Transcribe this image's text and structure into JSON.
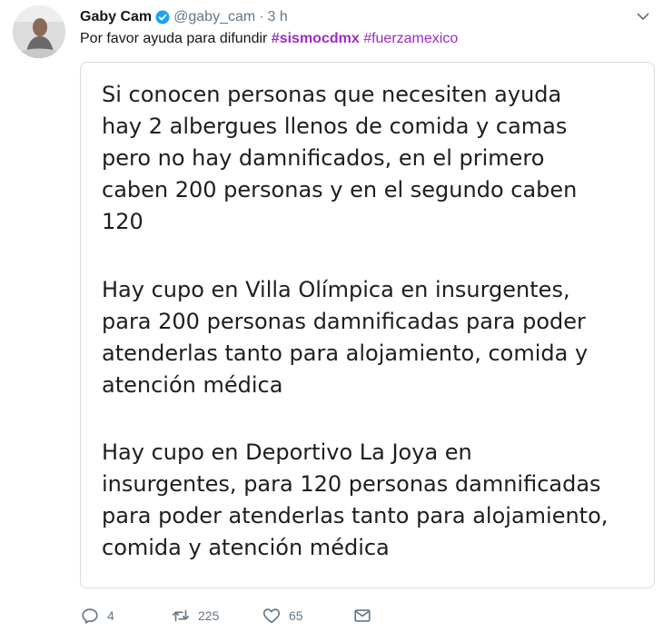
{
  "author": {
    "name": "Gaby Cam",
    "handle": "@gaby_cam",
    "separator": "·",
    "time": "3 h"
  },
  "tweet": {
    "text": "Por favor ayuda para difundir ",
    "hashtag1": "#sismocdmx",
    "hashtag2": "#fuerzamexico"
  },
  "image": {
    "paragraph1": "Si conocen personas que necesiten ayuda\nhay 2 albergues llenos de comida y camas\npero no hay damnificados, en el primero\ncaben 200 personas y en el segundo caben\n120",
    "paragraph2": "Hay cupo en Villa Olímpica en insurgentes,\npara 200 personas damnificadas para poder\natenderlas tanto para alojamiento, comida y\natención médica",
    "paragraph3": "Hay cupo en Deportivo La Joya en\ninsurgentes, para 120 personas damnificadas\npara poder atenderlas tanto para alojamiento,\ncomida y atención médica"
  },
  "actions": {
    "replies": "4",
    "retweets": "225",
    "likes": "65"
  },
  "icons": {
    "verified": "verified-badge-icon",
    "caret": "chevron-down-icon",
    "reply": "reply-icon",
    "retweet": "retweet-icon",
    "like": "heart-icon",
    "dm": "envelope-icon"
  },
  "colors": {
    "hashtag": "#9b2bc7",
    "verified": "#1da1f2",
    "meta": "#657786"
  }
}
